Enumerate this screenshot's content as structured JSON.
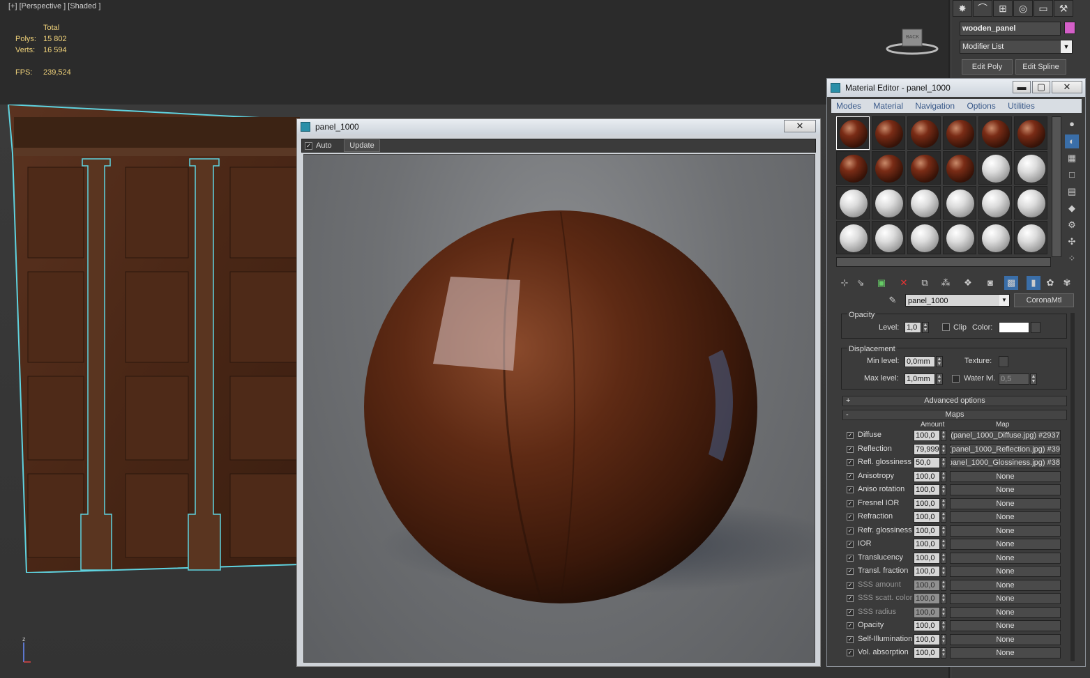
{
  "viewport": {
    "label": "[+] [Perspective ] [Shaded ]",
    "stats_header": "Total",
    "polys_label": "Polys:",
    "polys_value": "15 802",
    "verts_label": "Verts:",
    "verts_value": "16 594",
    "fps_label": "FPS:",
    "fps_value": "239,524",
    "viewcube_label": "BACK",
    "axis_label": "z"
  },
  "command_panel": {
    "object_name": "wooden_panel",
    "object_color": "#d45fc8",
    "modifier_list": "Modifier List",
    "edit_poly": "Edit Poly",
    "edit_spline": "Edit Spline",
    "tabs": [
      "create-icon",
      "modify-icon",
      "hierarchy-icon",
      "motion-icon",
      "display-icon",
      "utilities-icon"
    ]
  },
  "render_window": {
    "title": "panel_1000",
    "close": "✕",
    "auto_label": "Auto",
    "update_label": "Update"
  },
  "material_editor": {
    "title": "Material Editor - panel_1000",
    "menu": [
      "Modes",
      "Material",
      "Navigation",
      "Options",
      "Utilities"
    ],
    "slot_types": [
      "wood",
      "wood",
      "wood",
      "wood",
      "wood",
      "wood",
      "wood",
      "wood",
      "wood",
      "wood",
      "grey",
      "grey",
      "grey",
      "grey",
      "grey",
      "grey",
      "grey",
      "grey",
      "grey",
      "grey",
      "grey",
      "grey",
      "grey",
      "grey"
    ],
    "material_name": "panel_1000",
    "material_type": "CoronaMtl",
    "opacity": {
      "group": "Opacity",
      "level_label": "Level:",
      "level_value": "1,0",
      "clip_label": "Clip",
      "color_label": "Color:"
    },
    "displacement": {
      "group": "Displacement",
      "min_label": "Min level:",
      "min_value": "0,0mm",
      "max_label": "Max level:",
      "max_value": "1,0mm",
      "texture_label": "Texture:",
      "water_label": "Water lvl.",
      "water_value": "0,5"
    },
    "advanced_options": "Advanced options",
    "maps_title": "Maps",
    "amount_header": "Amount",
    "map_header": "Map",
    "maps": [
      {
        "label": "Diffuse",
        "amount": "100,0",
        "map": "#2937 (panel_1000_Diffuse.jpg)"
      },
      {
        "label": "Reflection",
        "amount": "79,999",
        "map": "#39 (panel_1000_Reflection.jpg)"
      },
      {
        "label": "Refl. glossiness",
        "amount": "50,0",
        "map": "#38 (panel_1000_Glossiness.jpg)"
      },
      {
        "label": "Anisotropy",
        "amount": "100,0",
        "map": "None"
      },
      {
        "label": "Aniso rotation",
        "amount": "100,0",
        "map": "None"
      },
      {
        "label": "Fresnel IOR",
        "amount": "100,0",
        "map": "None"
      },
      {
        "label": "Refraction",
        "amount": "100,0",
        "map": "None"
      },
      {
        "label": "Refr. glossiness",
        "amount": "100,0",
        "map": "None"
      },
      {
        "label": "IOR",
        "amount": "100,0",
        "map": "None"
      },
      {
        "label": "Translucency",
        "amount": "100,0",
        "map": "None"
      },
      {
        "label": "Transl. fraction",
        "amount": "100,0",
        "map": "None"
      },
      {
        "label": "SSS amount",
        "amount": "100,0",
        "map": "None"
      },
      {
        "label": "SSS scatt. color",
        "amount": "100,0",
        "map": "None"
      },
      {
        "label": "SSS radius",
        "amount": "100,0",
        "map": "None"
      },
      {
        "label": "Opacity",
        "amount": "100,0",
        "map": "None"
      },
      {
        "label": "Self-Illumination",
        "amount": "100,0",
        "map": "None"
      },
      {
        "label": "Vol. absorption",
        "amount": "100,0",
        "map": "None"
      }
    ]
  }
}
